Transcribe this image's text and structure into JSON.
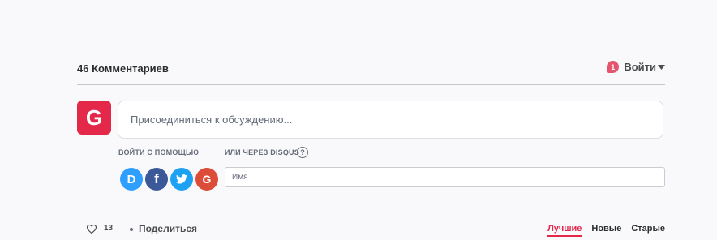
{
  "header": {
    "comment_count": "46 Комментариев",
    "notification_count": "1",
    "login_label": "Войти"
  },
  "user_avatar_letter": "G",
  "compose": {
    "placeholder": "Присоединиться к обсуждению..."
  },
  "login_with_label": "ВОЙТИ С ПОМОЩЬЮ",
  "or_disqus_label": "ИЛИ ЧЕРЕЗ DISQUS",
  "help_label": "?",
  "social_buttons": [
    {
      "name": "disqus",
      "letter": "D",
      "color": "#2e9fff"
    },
    {
      "name": "facebook",
      "letter": "f",
      "color": "#3b5998"
    },
    {
      "name": "twitter",
      "icon": "twitter-bird-icon",
      "color": "#1da1f2"
    },
    {
      "name": "google",
      "letter": "G",
      "color": "#dd4b39"
    }
  ],
  "name_field": {
    "placeholder": "Имя"
  },
  "footer": {
    "votes": "13",
    "share_label": "Поделиться",
    "sort_tabs": [
      {
        "label": "Лучшие",
        "active": true
      },
      {
        "label": "Новые",
        "active": false
      },
      {
        "label": "Старые",
        "active": false
      }
    ]
  },
  "colors": {
    "accent": "#e3284a",
    "notification": "#e3566d",
    "background": "#f9f8fa"
  }
}
